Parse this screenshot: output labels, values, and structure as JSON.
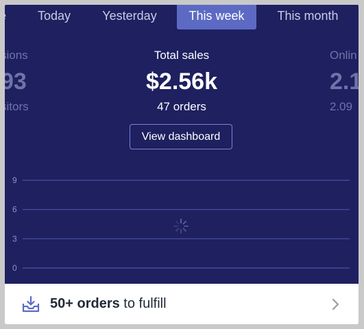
{
  "tabs": [
    {
      "label": "e",
      "active": false
    },
    {
      "label": "Today",
      "active": false
    },
    {
      "label": "Yesterday",
      "active": false
    },
    {
      "label": "This week",
      "active": true
    },
    {
      "label": "This month",
      "active": false
    }
  ],
  "stats": {
    "left": {
      "label": "sions",
      "value": "93",
      "sub": "sitors"
    },
    "center": {
      "label": "Total sales",
      "value": "$2.56k",
      "sub": "47 orders"
    },
    "right": {
      "label": "Onlin",
      "value": "2.1",
      "sub": "2.09"
    }
  },
  "dashboard_button": "View dashboard",
  "chart": {
    "type": "line",
    "y_ticks": [
      "9",
      "6",
      "3",
      "0"
    ],
    "ylim": [
      0,
      9
    ],
    "loading": true
  },
  "footer": {
    "count": "50+ orders",
    "suffix": " to fulfill"
  },
  "colors": {
    "background": "#1e2060",
    "accent": "#5c6ac4",
    "footer_bg": "#ffffff",
    "footer_text": "#212b36"
  },
  "icons": {
    "footer": "inbox-download-icon",
    "chevron": "chevron-right-icon",
    "loading": "spinner-icon"
  }
}
